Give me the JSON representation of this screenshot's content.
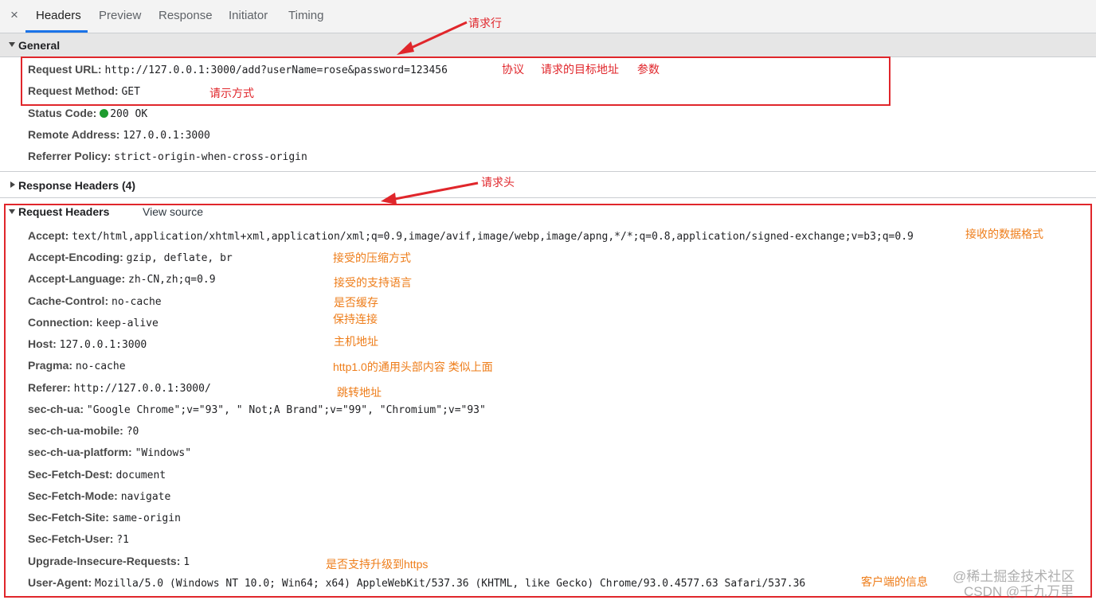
{
  "tabs": [
    {
      "label": "Headers",
      "active": true
    },
    {
      "label": "Preview"
    },
    {
      "label": "Response"
    },
    {
      "label": "Initiator"
    },
    {
      "label": "Timing"
    }
  ],
  "close_glyph": "×",
  "general": {
    "title": "General",
    "rows": [
      {
        "key": "Request URL:",
        "value": "http://127.0.0.1:3000/add?userName=rose&password=123456"
      },
      {
        "key": "Request Method:",
        "value": "GET"
      },
      {
        "key": "Status Code:",
        "value": "200 OK",
        "status_color": "#1e9c2f"
      },
      {
        "key": "Remote Address:",
        "value": "127.0.0.1:3000"
      },
      {
        "key": "Referrer Policy:",
        "value": "strict-origin-when-cross-origin"
      }
    ]
  },
  "response_headers": {
    "title": "Response Headers (4)"
  },
  "request_headers": {
    "title": "Request Headers",
    "view_source": "View source",
    "rows": [
      {
        "key": "Accept:",
        "value": "text/html,application/xhtml+xml,application/xml;q=0.9,image/avif,image/webp,image/apng,*/*;q=0.8,application/signed-exchange;v=b3;q=0.9"
      },
      {
        "key": "Accept-Encoding:",
        "value": "gzip, deflate, br"
      },
      {
        "key": "Accept-Language:",
        "value": "zh-CN,zh;q=0.9"
      },
      {
        "key": "Cache-Control:",
        "value": "no-cache"
      },
      {
        "key": "Connection:",
        "value": "keep-alive"
      },
      {
        "key": "Host:",
        "value": "127.0.0.1:3000"
      },
      {
        "key": "Pragma:",
        "value": "no-cache"
      },
      {
        "key": "Referer:",
        "value": "http://127.0.0.1:3000/"
      },
      {
        "key": "sec-ch-ua:",
        "value": "\"Google Chrome\";v=\"93\", \" Not;A Brand\";v=\"99\", \"Chromium\";v=\"93\""
      },
      {
        "key": "sec-ch-ua-mobile:",
        "value": "?0"
      },
      {
        "key": "sec-ch-ua-platform:",
        "value": "\"Windows\""
      },
      {
        "key": "Sec-Fetch-Dest:",
        "value": "document"
      },
      {
        "key": "Sec-Fetch-Mode:",
        "value": "navigate"
      },
      {
        "key": "Sec-Fetch-Site:",
        "value": "same-origin"
      },
      {
        "key": "Sec-Fetch-User:",
        "value": "?1"
      },
      {
        "key": "Upgrade-Insecure-Requests:",
        "value": "1"
      },
      {
        "key": "User-Agent:",
        "value": "Mozilla/5.0 (Windows NT 10.0; Win64; x64) AppleWebKit/537.36 (KHTML, like Gecko) Chrome/93.0.4577.63 Safari/537.36"
      }
    ]
  },
  "annotations": {
    "request_line": "请求行",
    "protocol": "协议",
    "target": "请求的目标地址",
    "params": "参数",
    "method": "请示方式",
    "request_head": "请求头",
    "accept": "接收的数据格式",
    "encoding": "接受的压缩方式",
    "language": "接受的支持语言",
    "cache": "是否缓存",
    "connection": "保持连接",
    "host": "主机地址",
    "pragma": "http1.0的通用头部内容  类似上面",
    "referer": "跳转地址",
    "upgrade": "是否支持升级到https",
    "ua": "客户端的信息"
  },
  "colors": {
    "annotation_red": "#e0262b",
    "annotation_orange": "#ee7d1a",
    "tab_accent": "#1a73e8"
  },
  "watermark": {
    "line1": "@稀土掘金技术社区",
    "line2": "CSDN @千九万里"
  }
}
